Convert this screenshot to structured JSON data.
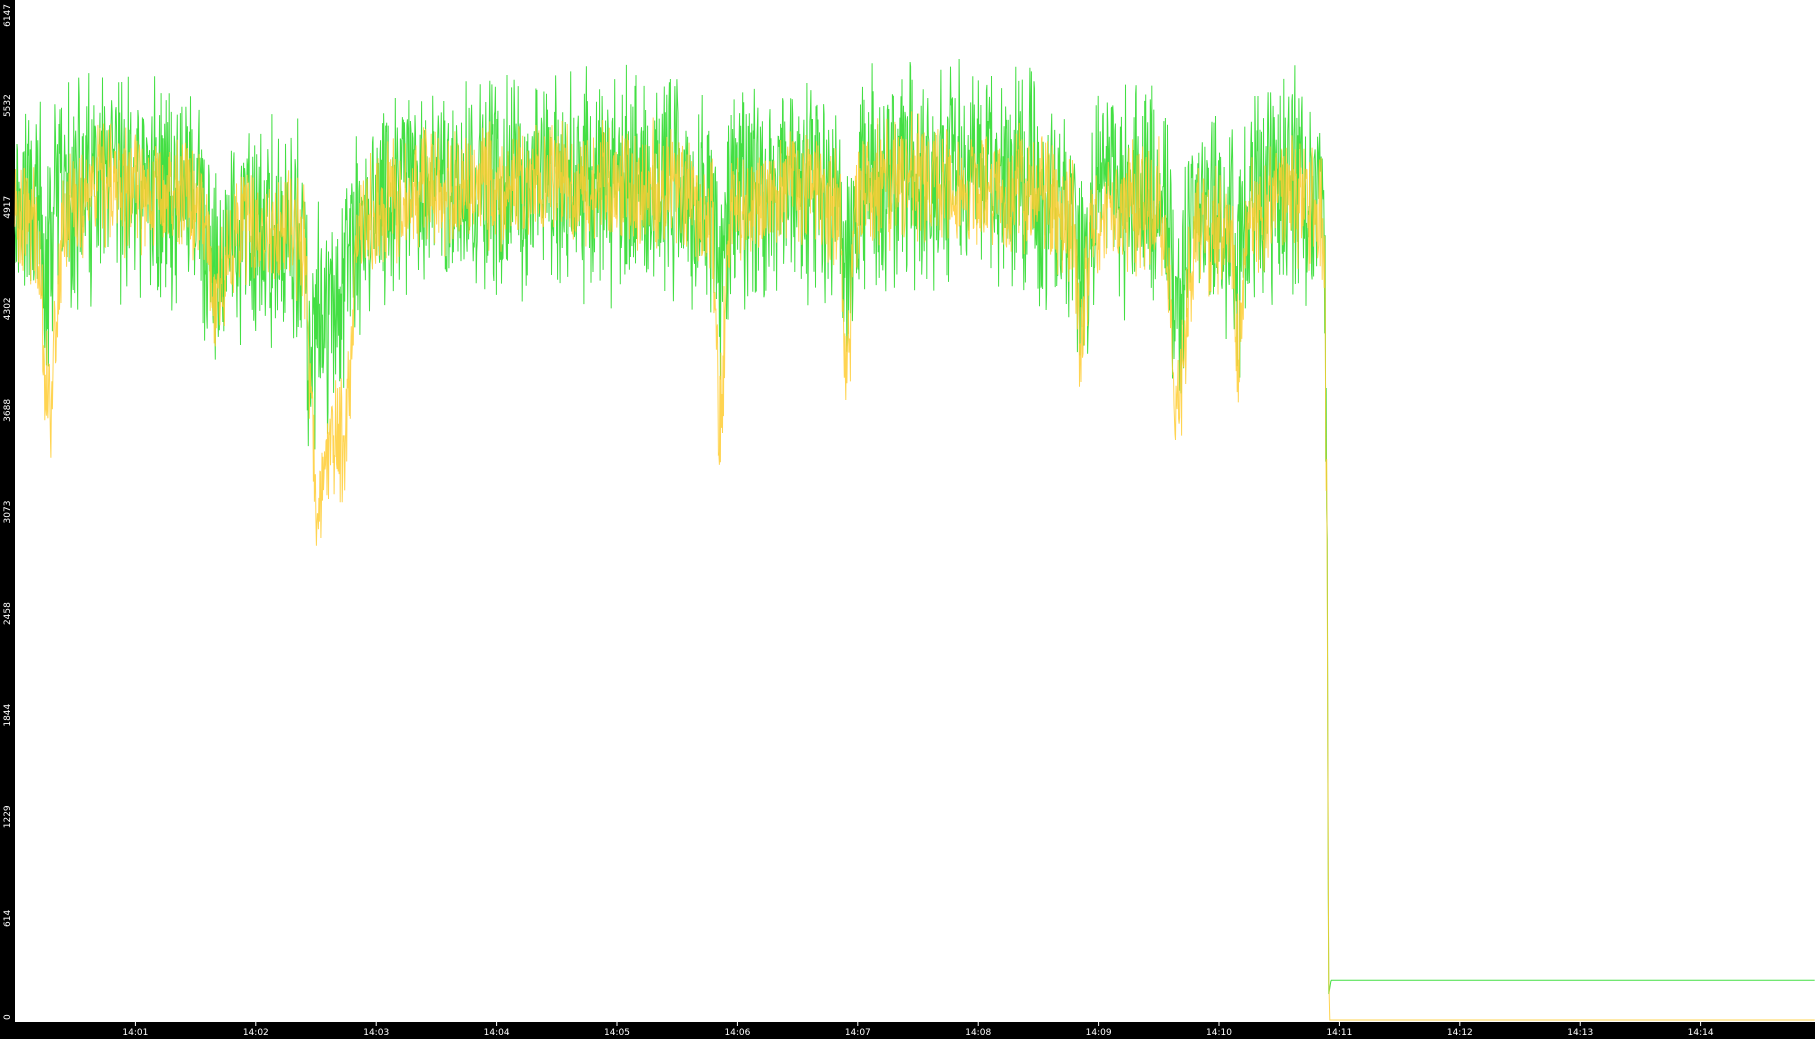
{
  "chart_data": {
    "type": "line",
    "title": "",
    "xlabel": "",
    "ylabel": "",
    "ylim": [
      0,
      6147
    ],
    "y_ticks": [
      "0",
      "614",
      "1229",
      "1844",
      "2458",
      "3073",
      "3688",
      "4302",
      "4917",
      "5532",
      "6147"
    ],
    "x_range_minutes": [
      0,
      14.95
    ],
    "x_ticks": [
      "14:01",
      "14:02",
      "14:03",
      "14:04",
      "14:05",
      "14:06",
      "14:07",
      "14:08",
      "14:09",
      "14:10",
      "14:11",
      "14:12",
      "14:13",
      "14:14"
    ],
    "x_tick_minutes": [
      1,
      2,
      3,
      4,
      5,
      6,
      7,
      8,
      9,
      10,
      11,
      12,
      13,
      14
    ],
    "grid": false,
    "legend": "none",
    "colors": {
      "background": "#ffffff",
      "axis_band": "#000000",
      "tick_text": "#ffffff"
    },
    "series": [
      {
        "color": "#2fdc2f",
        "style": "dense-oscillating",
        "points": [
          [
            0.0,
            5000
          ],
          [
            0.2,
            4900
          ],
          [
            0.25,
            4400
          ],
          [
            0.35,
            4950
          ],
          [
            0.6,
            5000
          ],
          [
            1.0,
            5050
          ],
          [
            1.5,
            5000
          ],
          [
            1.55,
            4800
          ],
          [
            1.65,
            4400
          ],
          [
            1.8,
            4750
          ],
          [
            2.4,
            4700
          ],
          [
            2.45,
            3900
          ],
          [
            2.55,
            4300
          ],
          [
            2.7,
            4200
          ],
          [
            2.8,
            4750
          ],
          [
            3.2,
            5000
          ],
          [
            4.0,
            5050
          ],
          [
            4.5,
            5050
          ],
          [
            5.0,
            5050
          ],
          [
            5.5,
            5080
          ],
          [
            5.8,
            4900
          ],
          [
            5.85,
            4300
          ],
          [
            5.95,
            4950
          ],
          [
            6.5,
            5100
          ],
          [
            6.85,
            5000
          ],
          [
            6.9,
            4500
          ],
          [
            7.0,
            5050
          ],
          [
            7.5,
            5150
          ],
          [
            8.0,
            5100
          ],
          [
            8.5,
            5050
          ],
          [
            8.8,
            4900
          ],
          [
            8.85,
            4400
          ],
          [
            8.95,
            4950
          ],
          [
            9.5,
            5000
          ],
          [
            9.6,
            4700
          ],
          [
            9.65,
            4300
          ],
          [
            9.8,
            4900
          ],
          [
            10.1,
            4850
          ],
          [
            10.15,
            4450
          ],
          [
            10.25,
            4900
          ],
          [
            10.5,
            5050
          ],
          [
            10.85,
            5050
          ],
          [
            10.88,
            4500
          ],
          [
            10.9,
            2470
          ],
          [
            10.91,
            150
          ],
          [
            10.93,
            240
          ],
          [
            12.0,
            240
          ],
          [
            13.0,
            240
          ],
          [
            14.0,
            240
          ],
          [
            14.95,
            240
          ]
        ],
        "amplitude": 680
      },
      {
        "color": "#ffcc33",
        "style": "dense-oscillating",
        "points": [
          [
            0.0,
            4950
          ],
          [
            0.2,
            4750
          ],
          [
            0.25,
            3900
          ],
          [
            0.3,
            3750
          ],
          [
            0.4,
            4850
          ],
          [
            0.6,
            5000
          ],
          [
            1.0,
            5050
          ],
          [
            1.5,
            5000
          ],
          [
            1.6,
            4700
          ],
          [
            1.65,
            4300
          ],
          [
            1.85,
            4800
          ],
          [
            2.4,
            4750
          ],
          [
            2.5,
            3100
          ],
          [
            2.6,
            3500
          ],
          [
            2.75,
            3500
          ],
          [
            2.85,
            4800
          ],
          [
            3.2,
            5000
          ],
          [
            4.0,
            5050
          ],
          [
            4.5,
            5050
          ],
          [
            5.0,
            5050
          ],
          [
            5.5,
            5050
          ],
          [
            5.8,
            4800
          ],
          [
            5.85,
            3500
          ],
          [
            5.95,
            4900
          ],
          [
            6.5,
            5050
          ],
          [
            6.85,
            4900
          ],
          [
            6.9,
            3800
          ],
          [
            7.0,
            5000
          ],
          [
            7.5,
            5100
          ],
          [
            8.0,
            5050
          ],
          [
            8.5,
            5000
          ],
          [
            8.8,
            4800
          ],
          [
            8.85,
            4050
          ],
          [
            8.95,
            4850
          ],
          [
            9.5,
            4950
          ],
          [
            9.6,
            4300
          ],
          [
            9.65,
            3600
          ],
          [
            9.8,
            4800
          ],
          [
            10.1,
            4750
          ],
          [
            10.15,
            4000
          ],
          [
            10.25,
            4850
          ],
          [
            10.5,
            5000
          ],
          [
            10.85,
            4900
          ],
          [
            10.88,
            4500
          ],
          [
            10.9,
            2500
          ],
          [
            10.91,
            300
          ],
          [
            10.92,
            0
          ],
          [
            12.0,
            0
          ],
          [
            13.0,
            0
          ],
          [
            14.0,
            0
          ],
          [
            14.95,
            0
          ]
        ],
        "amplitude": 380
      }
    ]
  }
}
